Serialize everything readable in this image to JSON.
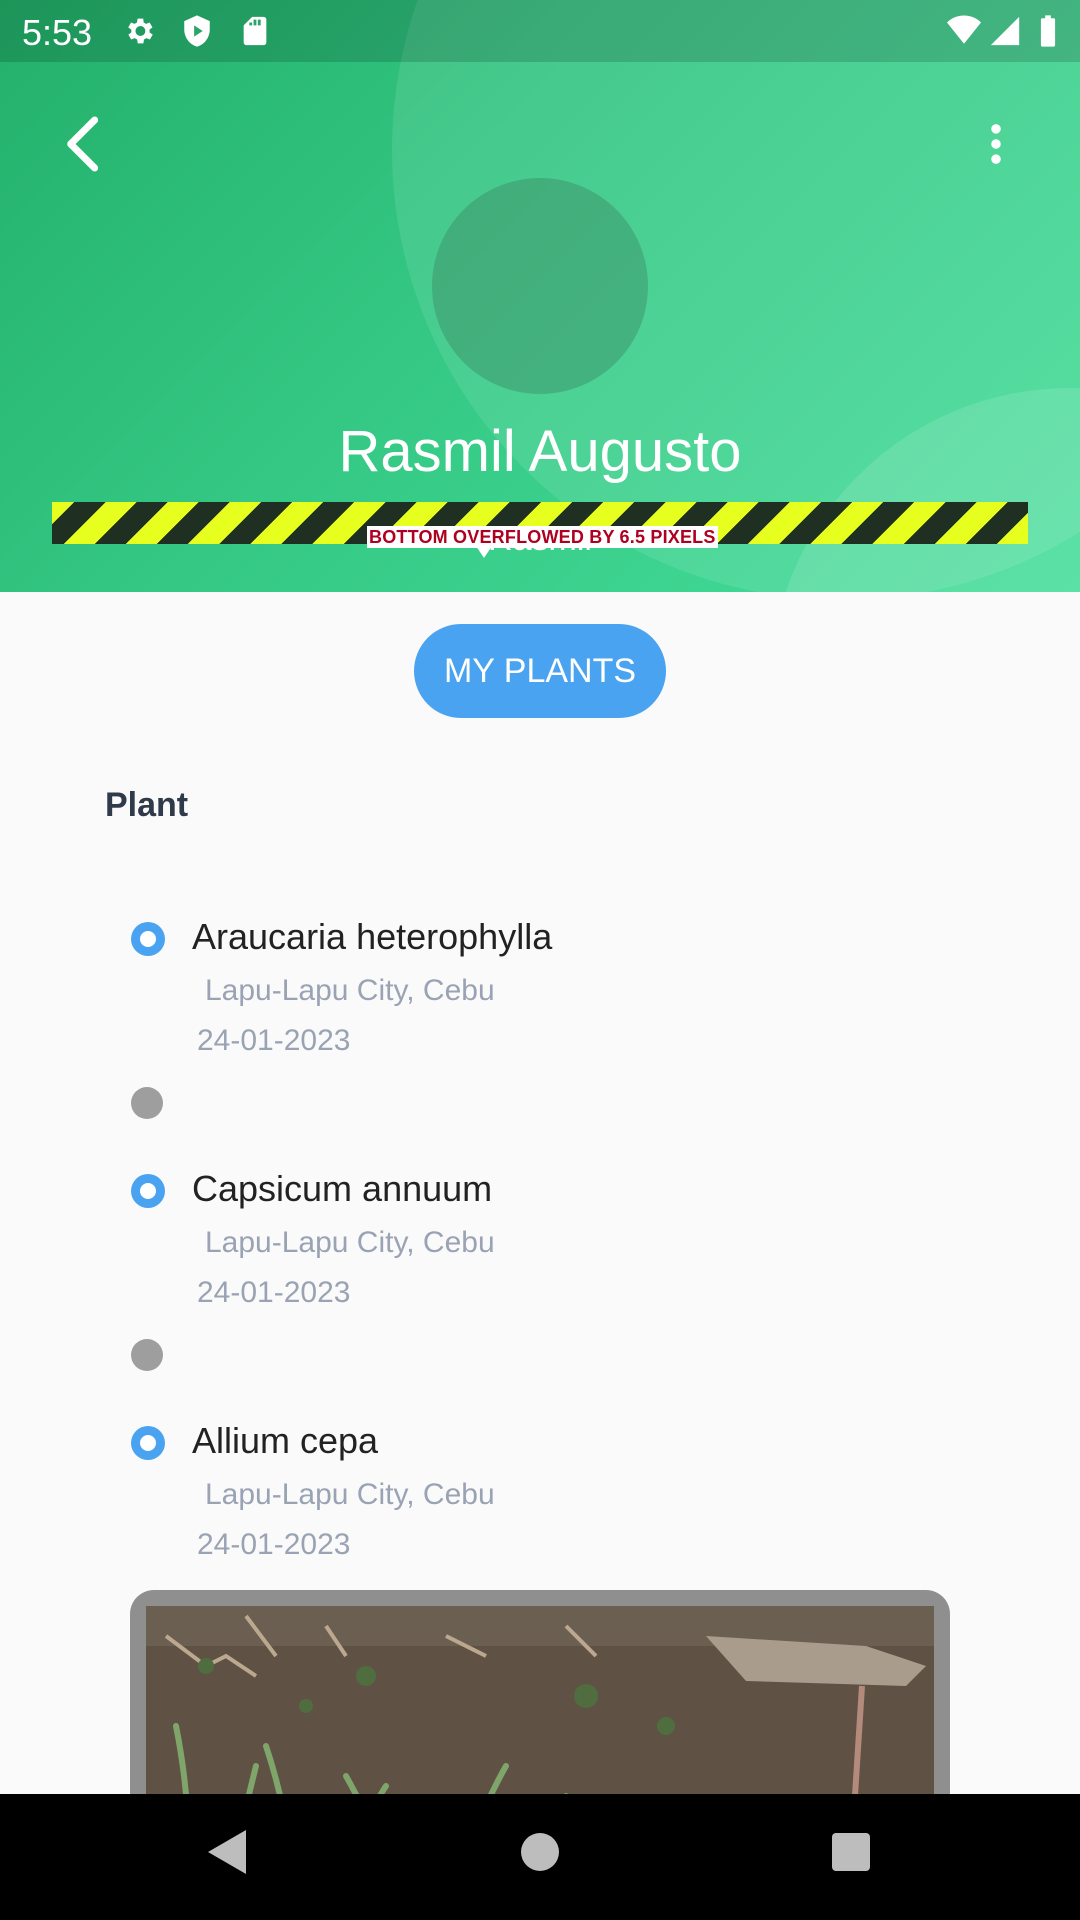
{
  "status_bar": {
    "time": "5:53"
  },
  "profile": {
    "name": "Rasmil Augusto",
    "subname": "Rasmil"
  },
  "overflow_warning": "BOTTOM OVERFLOWED BY 6.5 PIXELS",
  "tab_button": "MY PLANTS",
  "section_title": "Plant",
  "plants": [
    {
      "name": "Araucaria heterophylla",
      "location": "Lapu-Lapu City, Cebu",
      "date": "24-01-2023"
    },
    {
      "name": "Capsicum annuum",
      "location": "Lapu-Lapu City, Cebu",
      "date": "24-01-2023"
    },
    {
      "name": "Allium cepa",
      "location": "Lapu-Lapu City, Cebu",
      "date": "24-01-2023"
    }
  ],
  "icons": {
    "status": [
      "settings-icon",
      "shield-play-icon",
      "sd-card-icon",
      "wifi-icon",
      "signal-icon",
      "battery-icon"
    ],
    "header": [
      "back-arrow-icon",
      "more-vert-icon"
    ],
    "navbar": [
      "nav-back-icon",
      "nav-home-icon",
      "nav-recents-icon"
    ]
  },
  "colors": {
    "header_green": "#34c884",
    "accent_blue": "#4aa3f0",
    "muted_text": "#9aa3b3"
  }
}
